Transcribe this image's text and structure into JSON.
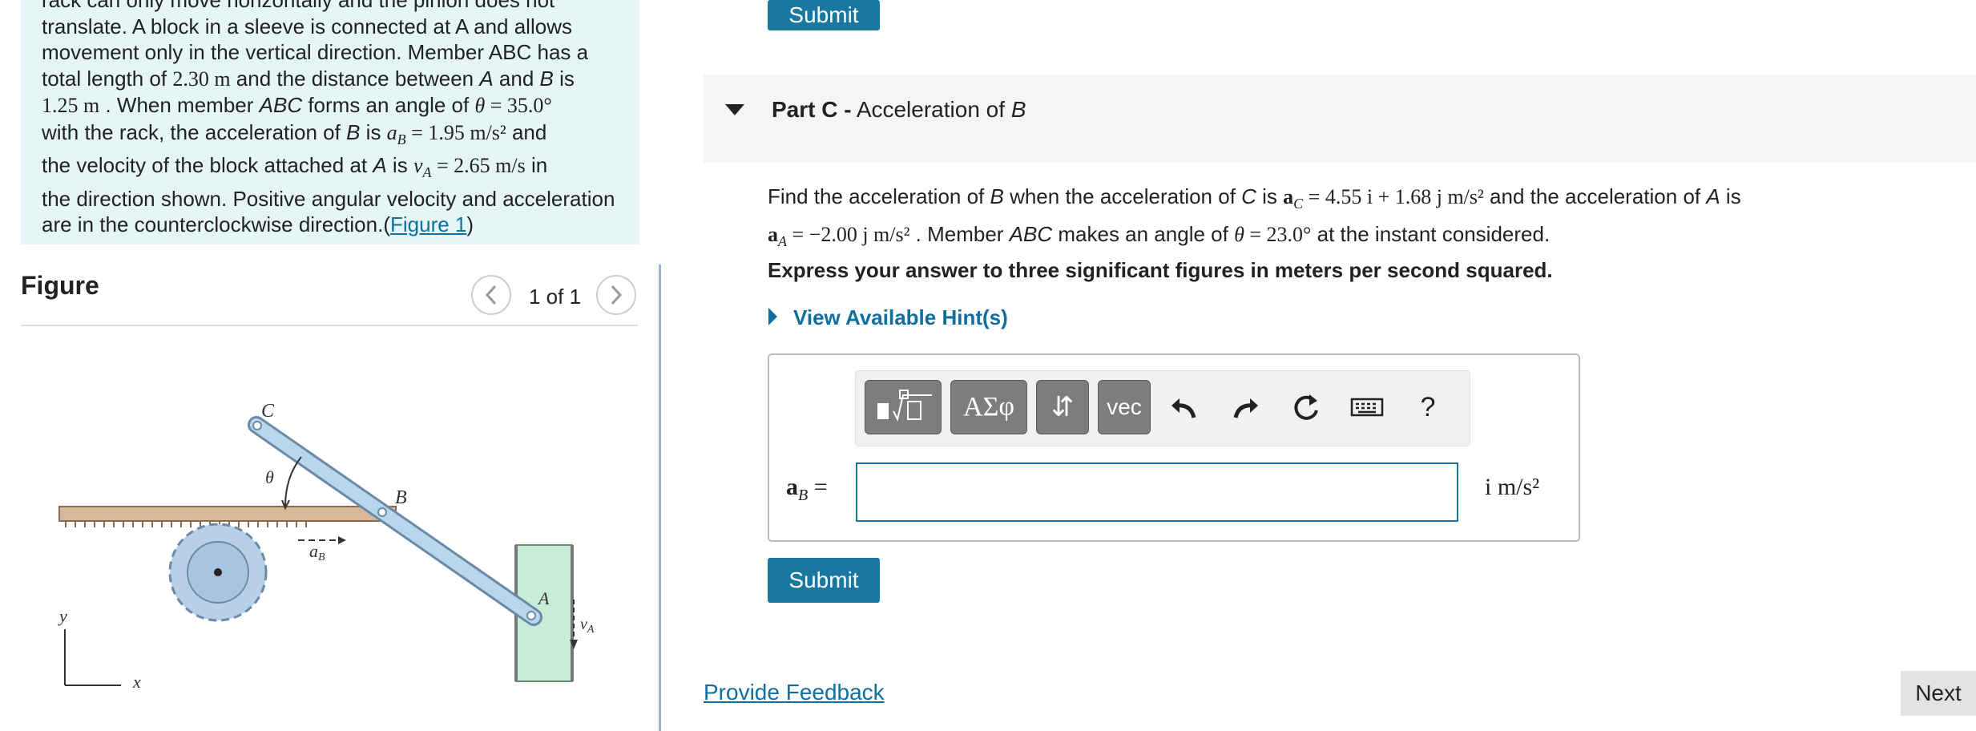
{
  "problem": {
    "line1": "rack can only move horizontally and the pinion does not",
    "line2": "translate. A block in a sleeve is connected at A and allows",
    "line3": "movement only in the vertical direction. Member ABC has a",
    "length": "2.30 m",
    "distance": "1.25 m",
    "theta": "35.0°",
    "aB": "1.95 m/s²",
    "vA": "2.65 m/s",
    "line_dir1": "the direction shown. Positive angular velocity and acceleration",
    "line_dir2": "are in the counterclockwise direction.(",
    "figure_link": "Figure 1",
    "close_paren": ")"
  },
  "figure": {
    "title": "Figure",
    "count": "1 of 1",
    "prev_icon": "chevron-left-icon",
    "next_icon": "chevron-right-icon",
    "labels": {
      "C": "C",
      "B": "B",
      "A": "A",
      "theta": "θ",
      "aB": "a",
      "aB_sub": "B",
      "vA": "v",
      "vA_sub": "A",
      "y": "y",
      "x": "x"
    }
  },
  "top_submit": "Submit",
  "part": {
    "prefix": "Part C -",
    "title": " Acceleration of ",
    "var": "B"
  },
  "question": {
    "aC": "4.55 i + 1.68 j m/s²",
    "aA": "−2.00 j m/s²",
    "theta": "23.0°"
  },
  "instruction": "Express your answer to three significant figures in meters per second squared.",
  "hint_link": "View Available Hint(s)",
  "toolbar": {
    "templates_icon": "templates-icon",
    "greek": "ΑΣφ",
    "arrows": "⇵",
    "vec": "vec",
    "undo_icon": "undo-icon",
    "redo_icon": "redo-icon",
    "reset_icon": "reset-icon",
    "keyboard_icon": "keyboard-icon",
    "help": "?"
  },
  "answer": {
    "label": "a",
    "label_sub": "B",
    "eq": " =",
    "value": "",
    "units": "i m/s²"
  },
  "submit": "Submit",
  "feedback": "Provide Feedback",
  "next": "Next",
  "colors": {
    "accent": "#1a78a0",
    "link": "#0f6f9f",
    "problem_bg": "#e6f6f6"
  }
}
